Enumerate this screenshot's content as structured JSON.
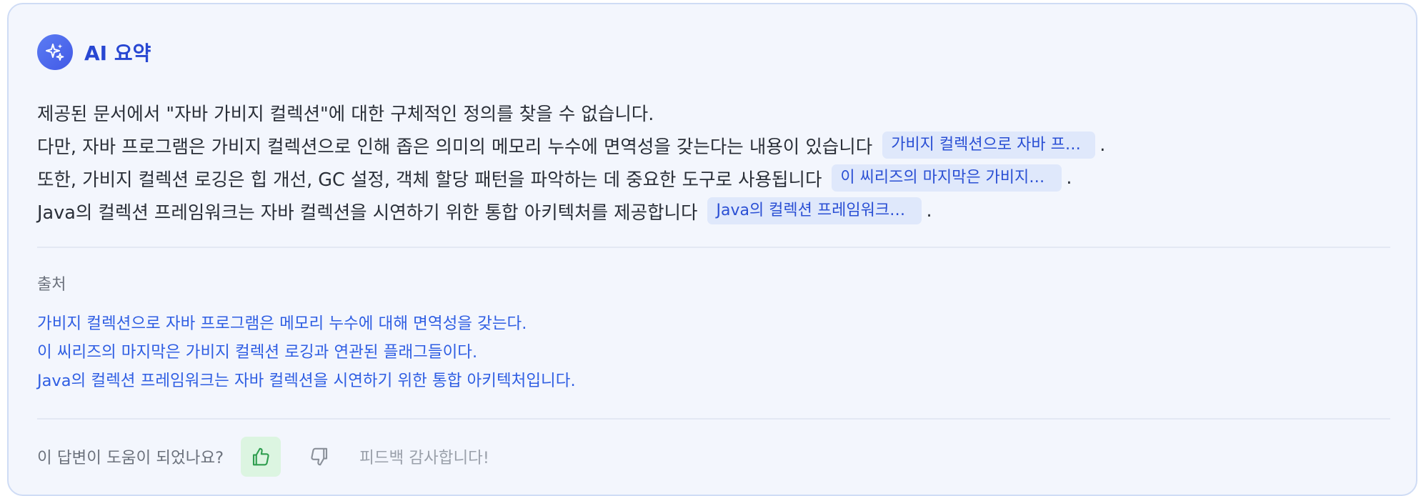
{
  "header": {
    "title": "AI 요약",
    "icon": "sparkles-icon"
  },
  "summary": {
    "lines": [
      {
        "text": "제공된 문서에서 \"자바 가비지 컬렉션\"에 대한 구체적인 정의를 찾을 수 없습니다."
      },
      {
        "text": "다만, 자바 프로그램은 가비지 컬렉션으로 인해 좁은 의미의 메모리 누수에 면역성을 갖는다는 내용이 있습니다",
        "citation": "가비지 컬렉션으로 자바 프로…",
        "end": "."
      },
      {
        "text": "또한, 가비지 컬렉션 로깅은 힙 개선, GC 설정, 객체 할당 패턴을 파악하는 데 중요한 도구로 사용됩니다",
        "citation": "이 씨리즈의 마지막은 가비지…",
        "end": "."
      },
      {
        "text": "Java의 컬렉션 프레임워크는 자바 컬렉션을 시연하기 위한 통합 아키텍처를 제공합니다",
        "citation": "Java의 컬렉션 프레임워크…",
        "end": "."
      }
    ]
  },
  "sources": {
    "title": "출처",
    "links": [
      "가비지 컬렉션으로 자바 프로그램은 메모리 누수에 대해 면역성을 갖는다.",
      "이 씨리즈의 마지막은 가비지 컬렉션 로깅과 연관된 플래그들이다.",
      "Java의 컬렉션 프레임워크는 자바 컬렉션을 시연하기 위한 통합 아키텍처입니다."
    ]
  },
  "feedback": {
    "question": "이 답변이 도움이 되었나요?",
    "thumbs_up_icon": "thumbs-up-icon",
    "thumbs_down_icon": "thumbs-down-icon",
    "thanks": "피드백 감사합니다!"
  },
  "colors": {
    "accent": "#2847d2",
    "link": "#2f5ee3",
    "card_bg": "#f3f6fd",
    "chip_bg": "#dfe8fb",
    "thumb_up_bg": "#dcf5e1",
    "thumb_up_stroke": "#2f9e4f"
  }
}
